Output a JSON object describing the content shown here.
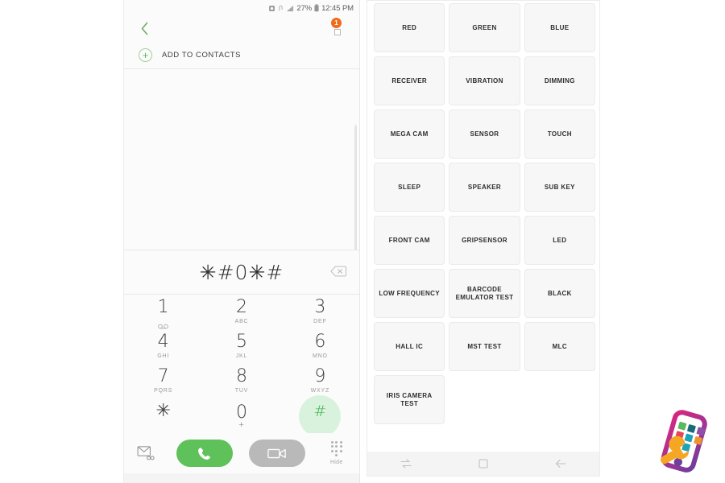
{
  "dialer": {
    "statusbar": {
      "battery_percent": "27%",
      "time": "12:45 PM",
      "icons": [
        "alarm-icon",
        "nfc-icon",
        "signal-icon",
        "battery-icon"
      ]
    },
    "appbar": {
      "back_icon": "back-chevron-icon",
      "badge_count": "1"
    },
    "add_to_contacts": {
      "label": "ADD TO CONTACTS",
      "icon": "plus-icon"
    },
    "display": {
      "number": "✳#0✳#",
      "backspace_icon": "backspace-icon"
    },
    "keys": [
      {
        "digit": "1",
        "sub": "",
        "icon": "voicemail-icon",
        "active": false
      },
      {
        "digit": "2",
        "sub": "ABC",
        "icon": "",
        "active": false
      },
      {
        "digit": "3",
        "sub": "DEF",
        "icon": "",
        "active": false
      },
      {
        "digit": "4",
        "sub": "GHI",
        "icon": "",
        "active": false
      },
      {
        "digit": "5",
        "sub": "JKL",
        "icon": "",
        "active": false
      },
      {
        "digit": "6",
        "sub": "MNO",
        "icon": "",
        "active": false
      },
      {
        "digit": "7",
        "sub": "PQRS",
        "icon": "",
        "active": false
      },
      {
        "digit": "8",
        "sub": "TUV",
        "icon": "",
        "active": false
      },
      {
        "digit": "9",
        "sub": "WXYZ",
        "icon": "",
        "active": false
      },
      {
        "digit": "✳",
        "sub": "",
        "icon": "",
        "active": false
      },
      {
        "digit": "0",
        "sub": "+",
        "icon": "",
        "active": false
      },
      {
        "digit": "#",
        "sub": "",
        "icon": "",
        "active": true
      }
    ],
    "actions": {
      "message_icon": "message-icon",
      "call_icon": "phone-call-icon",
      "video_icon": "video-call-icon",
      "hide_label": "Hide",
      "hide_icon": "keypad-dots-icon"
    },
    "colors": {
      "call_green": "#5ec15a",
      "key_highlight": "#d9f2dd",
      "key_active_text": "#3bb04a",
      "badge_orange": "#ef6c1f",
      "video_gray": "#b9b9b9"
    }
  },
  "service_menu": {
    "tiles": [
      "RED",
      "GREEN",
      "BLUE",
      "RECEIVER",
      "VIBRATION",
      "DIMMING",
      "MEGA CAM",
      "SENSOR",
      "TOUCH",
      "SLEEP",
      "SPEAKER",
      "SUB KEY",
      "FRONT CAM",
      "GRIPSENSOR",
      "LED",
      "LOW FREQUENCY",
      "BARCODE\nEMULATOR TEST",
      "BLACK",
      "HALL IC",
      "MST TEST",
      "MLC",
      "IRIS CAMERA TEST"
    ],
    "navbar": {
      "recents_icon": "recents-icon",
      "home_icon": "home-square-icon",
      "back_icon": "back-arrow-icon"
    }
  },
  "watermark": {
    "logo_icon": "smartphone-wrench-logo",
    "colors": {
      "frame_magenta": "#d5277f",
      "frame_purple": "#7b3b96",
      "wrench_orange": "#f5a623",
      "app_green": "#5cb85c",
      "app_teal": "#1a6b7a",
      "app_purple": "#8e4fa8",
      "app_red": "#e8445a",
      "app_cyan": "#20a3b8",
      "app_orange": "#f0932b"
    }
  }
}
